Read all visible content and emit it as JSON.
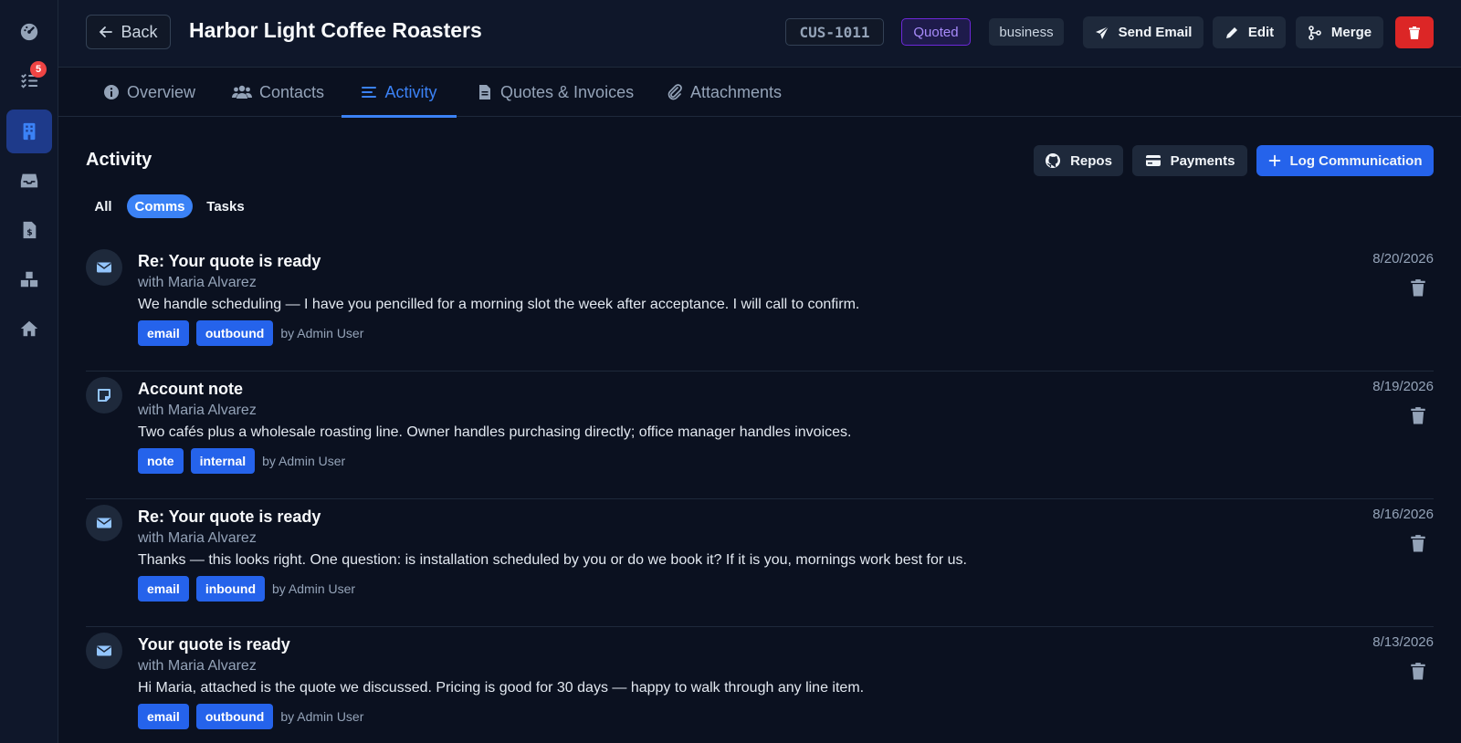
{
  "colors": {
    "accent": "#3b82f6",
    "background": "#0b1120",
    "status_quoted": "#a78bfa",
    "danger": "#dc2626",
    "badge": "#ef4444"
  },
  "sidebar": {
    "items": [
      {
        "icon": "dashboard-gauge-icon"
      },
      {
        "icon": "task-list-icon",
        "badge": "5"
      },
      {
        "icon": "building-icon",
        "active": true
      },
      {
        "icon": "inbox-icon"
      },
      {
        "icon": "invoice-file-icon"
      },
      {
        "icon": "boxes-icon"
      },
      {
        "icon": "home-icon"
      }
    ]
  },
  "header": {
    "back_label": "Back",
    "title": "Harbor Light Coffee Roasters",
    "customer_id": "CUS-1011",
    "status": "Quoted",
    "type": "business",
    "send_email_label": "Send Email",
    "edit_label": "Edit",
    "merge_label": "Merge"
  },
  "tabs": [
    {
      "label": "Overview",
      "icon": "info-circle-icon"
    },
    {
      "label": "Contacts",
      "icon": "users-icon"
    },
    {
      "label": "Activity",
      "icon": "list-icon",
      "active": true
    },
    {
      "label": "Quotes & Invoices",
      "icon": "document-icon"
    },
    {
      "label": "Attachments",
      "icon": "paperclip-icon"
    }
  ],
  "activity": {
    "title": "Activity",
    "repos_label": "Repos",
    "payments_label": "Payments",
    "log_label": "Log Communication",
    "filters": [
      "All",
      "Comms",
      "Tasks"
    ],
    "active_filter": "Comms",
    "items": [
      {
        "kind": "email",
        "title": "Re: Your quote is ready",
        "with": "with Maria Alvarez",
        "body": "We handle scheduling — I have you pencilled for a morning slot the week after acceptance. I will call to confirm.",
        "tags": [
          "email",
          "outbound"
        ],
        "by": "by Admin User",
        "date": "8/20/2026"
      },
      {
        "kind": "note",
        "title": "Account note",
        "with": "with Maria Alvarez",
        "body": "Two cafés plus a wholesale roasting line. Owner handles purchasing directly; office manager handles invoices.",
        "tags": [
          "note",
          "internal"
        ],
        "by": "by Admin User",
        "date": "8/19/2026"
      },
      {
        "kind": "email",
        "title": "Re: Your quote is ready",
        "with": "with Maria Alvarez",
        "body": "Thanks — this looks right. One question: is installation scheduled by you or do we book it? If it is you, mornings work best for us.",
        "tags": [
          "email",
          "inbound"
        ],
        "by": "by Admin User",
        "date": "8/16/2026"
      },
      {
        "kind": "email",
        "title": "Your quote is ready",
        "with": "with Maria Alvarez",
        "body": "Hi Maria, attached is the quote we discussed. Pricing is good for 30 days — happy to walk through any line item.",
        "tags": [
          "email",
          "outbound"
        ],
        "by": "by Admin User",
        "date": "8/13/2026"
      }
    ]
  }
}
